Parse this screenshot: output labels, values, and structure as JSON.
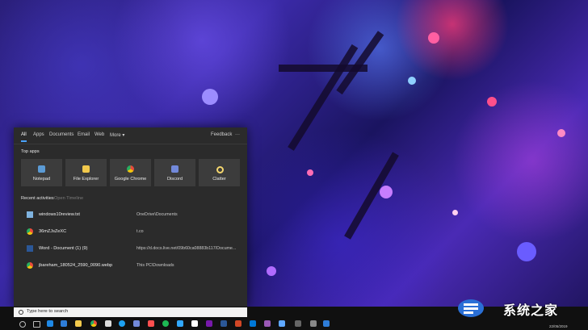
{
  "search_panel": {
    "tabs": [
      "All",
      "Apps",
      "Documents",
      "Email",
      "Web",
      "More ▾"
    ],
    "feedback_label": "Feedback",
    "more_options_label": "···",
    "top_apps_heading": "Top apps",
    "top_apps": [
      {
        "label": "Notepad",
        "icon": "notepad-icon",
        "color": "#5b9bd5"
      },
      {
        "label": "File Explorer",
        "icon": "folder-icon",
        "color": "#f2c94c"
      },
      {
        "label": "Google Chrome",
        "icon": "chrome-icon",
        "color": "#e74c3c"
      },
      {
        "label": "Discord",
        "icon": "discord-icon",
        "color": "#7289da"
      },
      {
        "label": "Clatter",
        "icon": "clatter-icon",
        "color": "#f5d76e"
      }
    ],
    "recent_heading": "Recent activities",
    "open_timeline_label": "Open Timeline",
    "recent": [
      {
        "name": "windows10review.txt",
        "path": "OneDrive\\Documents",
        "icon": "notepad-icon",
        "color": "#7fb3e0"
      },
      {
        "name": "36mZJsZeXC",
        "path": "t.co",
        "icon": "chrome-icon",
        "color": "#e74c3c"
      },
      {
        "name": "Word - Document (1) (9)",
        "path": "https://d.docs.live.net/09b60ca08883b117/Docume...",
        "icon": "word-icon",
        "color": "#2b5797"
      },
      {
        "name": "jbareham_180524_2590_0090.webp",
        "path": "This PC\\Downloads",
        "icon": "chrome-icon",
        "color": "#e74c3c"
      }
    ]
  },
  "taskbar": {
    "search_placeholder": "Type here to search",
    "clock": "22/05/2019"
  },
  "watermark": {
    "text": "系统之家"
  }
}
